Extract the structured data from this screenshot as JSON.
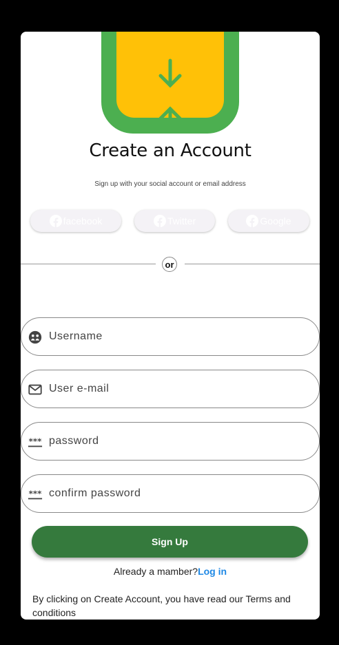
{
  "header": {
    "title": "Create an Account",
    "subtitle": "Sign up with your social account or email address"
  },
  "social": {
    "facebook_label": "facebook",
    "twitter_label": "Twitter",
    "google_label": "Google"
  },
  "divider": {
    "label": "or"
  },
  "form": {
    "username_placeholder": "Username",
    "email_placeholder": "User e-mail",
    "password_placeholder": "password",
    "confirm_placeholder": "confirm password",
    "submit_label": "Sign Up"
  },
  "footer": {
    "already_text": "Already a mamber?",
    "login_label": "Log in",
    "terms_text": "By clicking on Create Account, you have read our Terms and conditions"
  },
  "colors": {
    "primary": "#357a3d",
    "logo_green": "#4caf50",
    "logo_yellow": "#ffc107",
    "link": "#1e88e5"
  },
  "icons": [
    "arrow-down-icon",
    "arrow-up-icon",
    "facebook-icon",
    "user-group-icon",
    "mail-icon",
    "password-icon"
  ]
}
